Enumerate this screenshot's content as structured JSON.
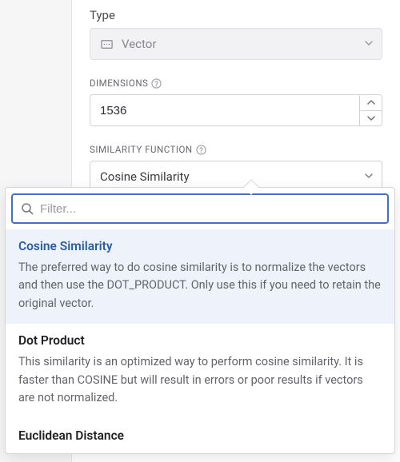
{
  "fields": {
    "type": {
      "label": "Type",
      "value": "Vector"
    },
    "dimensions": {
      "label": "DIMENSIONS",
      "value": "1536"
    },
    "similarity": {
      "label": "SIMILARITY FUNCTION",
      "value": "Cosine Similarity"
    }
  },
  "dropdown": {
    "filter_placeholder": "Filter...",
    "options": [
      {
        "title": "Cosine Similarity",
        "desc": "The preferred way to do cosine similarity is to normalize the vectors and then use the DOT_PRODUCT. Only use this if you need to retain the original vector.",
        "selected": true
      },
      {
        "title": "Dot Product",
        "desc": "This similarity is an optimized way to perform cosine similarity. It is faster than COSINE but will result in errors or poor results if vectors are not normalized.",
        "selected": false
      },
      {
        "title": "Euclidean Distance",
        "desc": "",
        "selected": false
      }
    ]
  }
}
